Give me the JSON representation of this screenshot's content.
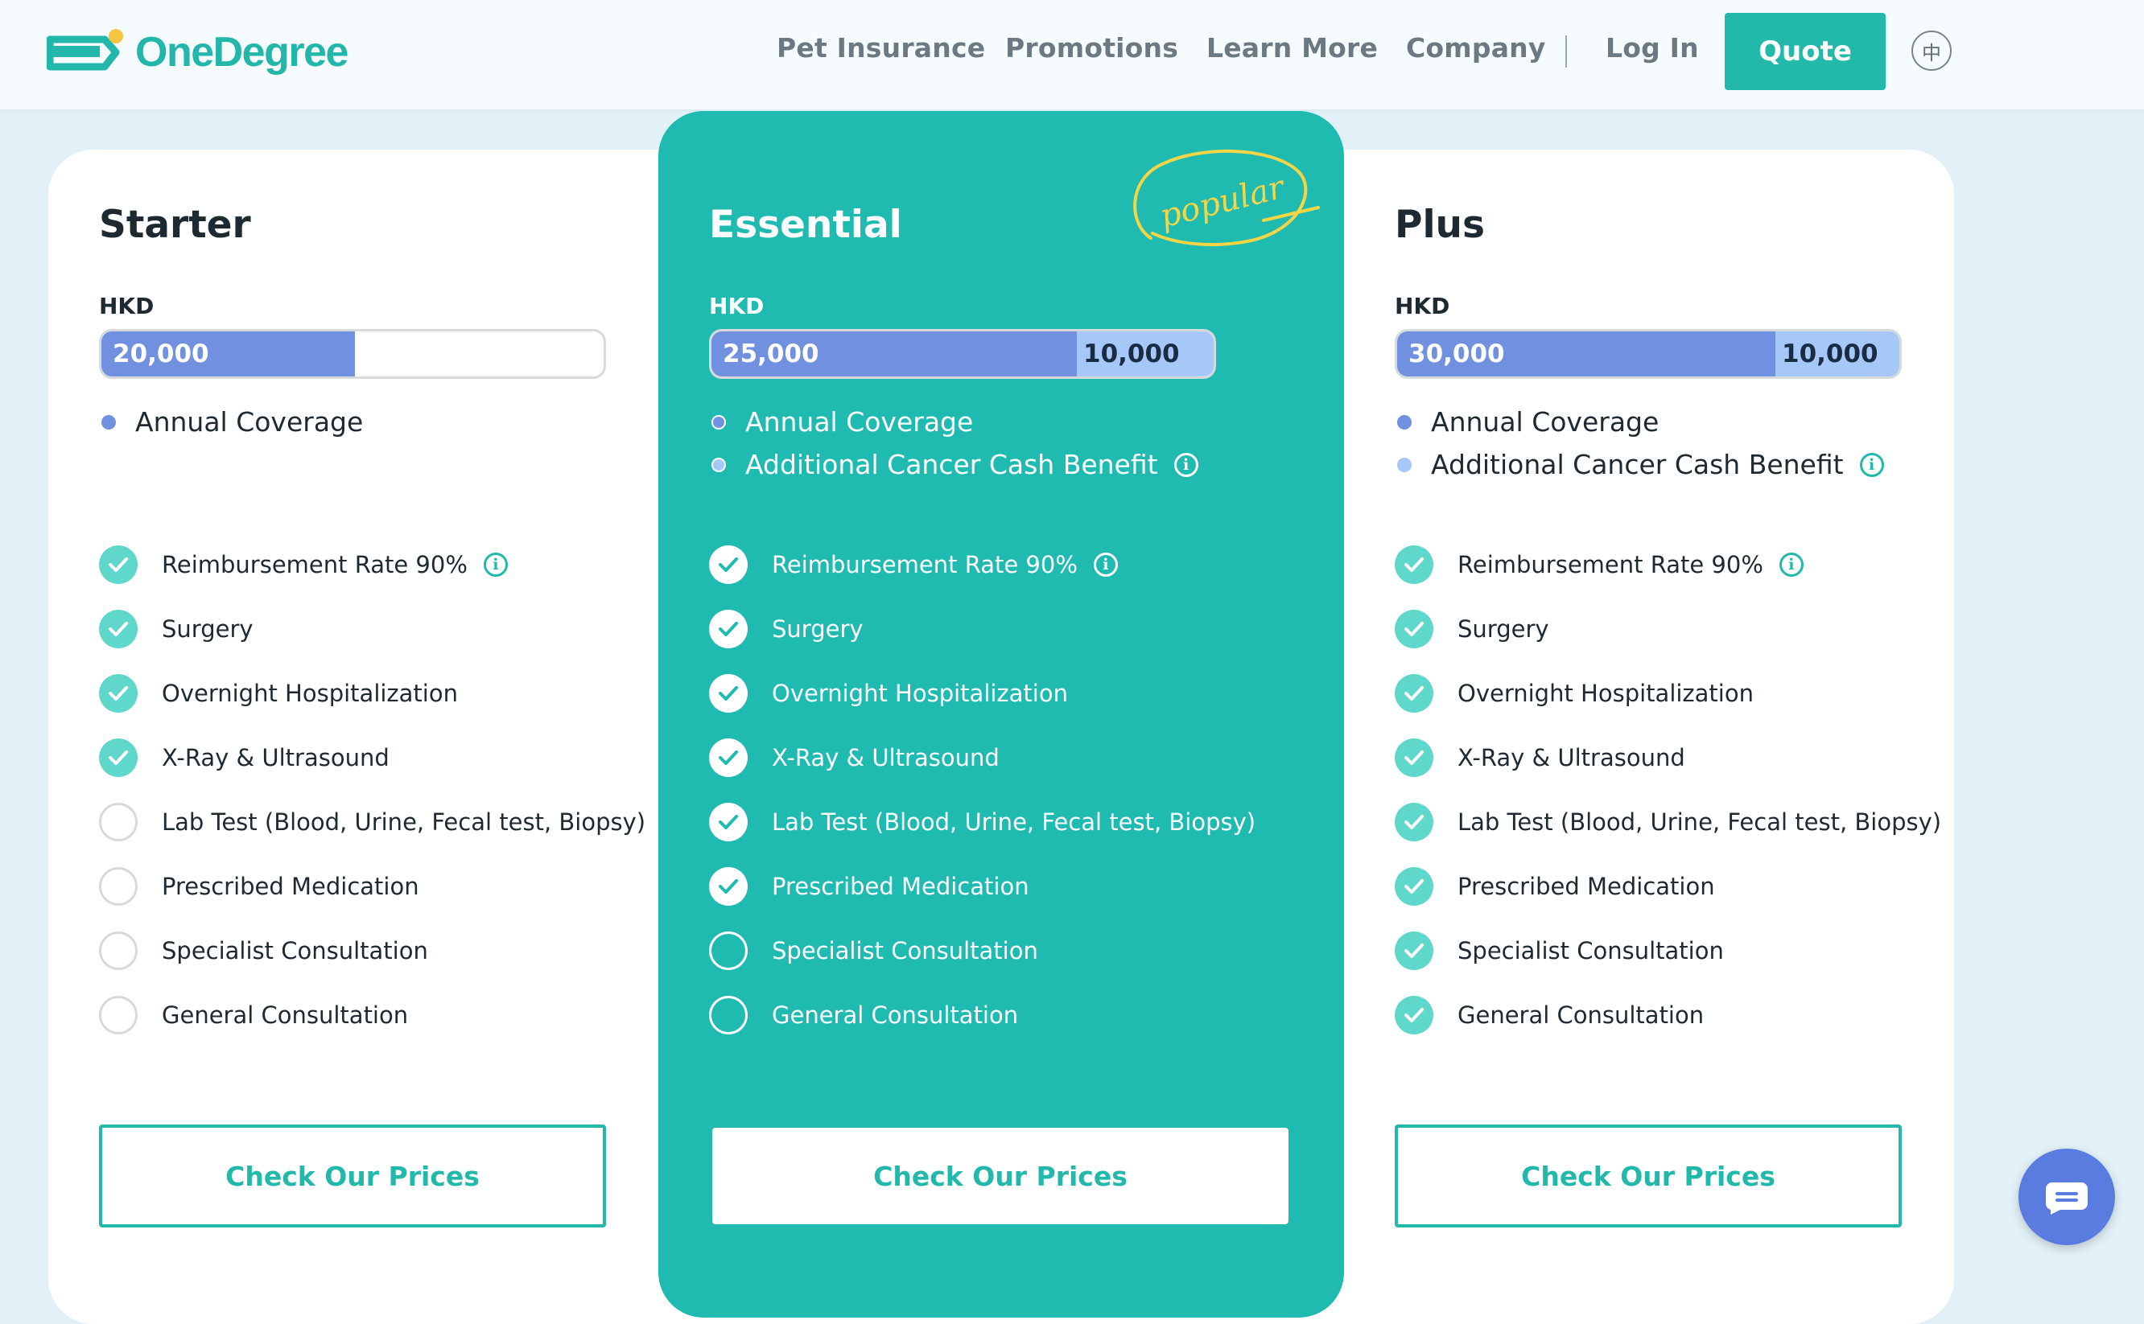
{
  "header": {
    "brand": "OneDegree",
    "nav": [
      "Pet Insurance",
      "Promotions",
      "Learn More",
      "Company"
    ],
    "login": "Log In",
    "quote": "Quote",
    "lang": "中"
  },
  "colors": {
    "teal": "#22b8aa",
    "coverage": "#7190e0",
    "cancer_benefit": "#a6c8f8"
  },
  "legend": {
    "annual": "Annual Coverage",
    "cancer": "Additional Cancer Cash Benefit"
  },
  "features": [
    "Reimbursement Rate 90%",
    "Surgery",
    "Overnight Hospitalization",
    "X-Ray & Ultrasound",
    "Lab Test (Blood, Urine, Fecal test, Biopsy)",
    "Prescribed Medication",
    "Specialist Consultation",
    "General Consultation"
  ],
  "plans": [
    {
      "name": "Starter",
      "currency": "HKD",
      "coverage": "20,000",
      "cancer_benefit": "",
      "included": [
        true,
        true,
        true,
        true,
        false,
        false,
        false,
        false
      ],
      "cta": "Check Our Prices"
    },
    {
      "name": "Essential",
      "badge": "popular",
      "currency": "HKD",
      "coverage": "25,000",
      "cancer_benefit": "10,000",
      "included": [
        true,
        true,
        true,
        true,
        true,
        true,
        false,
        false
      ],
      "cta": "Check Our Prices"
    },
    {
      "name": "Plus",
      "currency": "HKD",
      "coverage": "30,000",
      "cancer_benefit": "10,000",
      "included": [
        true,
        true,
        true,
        true,
        true,
        true,
        true,
        true
      ],
      "cta": "Check Our Prices"
    }
  ]
}
